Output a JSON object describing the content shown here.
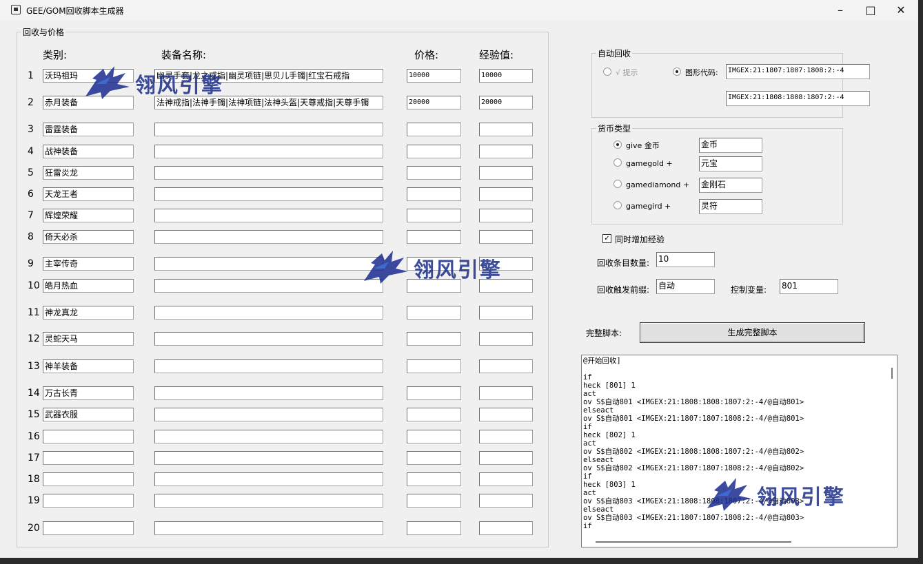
{
  "window": {
    "title": "GEE/GOM回收脚本生成器"
  },
  "recycle": {
    "legend": "回收与价格",
    "headers": {
      "category": "类别:",
      "names": "装备名称:",
      "price": "价格:",
      "exp": "经验值:"
    },
    "rows": [
      {
        "n": "1",
        "category": "沃玛祖玛",
        "names": "幽灵手套|龙之戒指|幽灵项链|思贝儿手镯|红宝石戒指",
        "price": "10000",
        "exp": "10000"
      },
      {
        "n": "2",
        "category": "赤月装备",
        "names": "法神戒指|法神手镯|法神项链|法神头盔|天尊戒指|天尊手镯",
        "price": "20000",
        "exp": "20000"
      },
      {
        "n": "3",
        "category": "雷霆装备",
        "names": "",
        "price": "",
        "exp": ""
      },
      {
        "n": "4",
        "category": "战神装备",
        "names": "",
        "price": "",
        "exp": ""
      },
      {
        "n": "5",
        "category": "狂雷炎龙",
        "names": "",
        "price": "",
        "exp": ""
      },
      {
        "n": "6",
        "category": "天龙王者",
        "names": "",
        "price": "",
        "exp": ""
      },
      {
        "n": "7",
        "category": "辉煌荣耀",
        "names": "",
        "price": "",
        "exp": ""
      },
      {
        "n": "8",
        "category": "倚天必杀",
        "names": "",
        "price": "",
        "exp": ""
      },
      {
        "n": "9",
        "category": "主宰传奇",
        "names": "",
        "price": "",
        "exp": ""
      },
      {
        "n": "10",
        "category": "皓月热血",
        "names": "",
        "price": "",
        "exp": ""
      },
      {
        "n": "11",
        "category": "神龙真龙",
        "names": "",
        "price": "",
        "exp": ""
      },
      {
        "n": "12",
        "category": "灵蛇天马",
        "names": "",
        "price": "",
        "exp": ""
      },
      {
        "n": "13",
        "category": "神羊装备",
        "names": "",
        "price": "",
        "exp": ""
      },
      {
        "n": "14",
        "category": "万古长青",
        "names": "",
        "price": "",
        "exp": ""
      },
      {
        "n": "15",
        "category": "武器衣服",
        "names": "",
        "price": "",
        "exp": ""
      },
      {
        "n": "16",
        "category": "",
        "names": "",
        "price": "",
        "exp": ""
      },
      {
        "n": "17",
        "category": "",
        "names": "",
        "price": "",
        "exp": ""
      },
      {
        "n": "18",
        "category": "",
        "names": "",
        "price": "",
        "exp": ""
      },
      {
        "n": "19",
        "category": "",
        "names": "",
        "price": "",
        "exp": ""
      },
      {
        "n": "20",
        "category": "",
        "names": "",
        "price": "",
        "exp": ""
      }
    ]
  },
  "auto": {
    "legend": "自动回收",
    "hint_label": "√ 提示",
    "graphic_label": "图形代码:",
    "code1": "IMGEX:21:1807:1807:1808:2:-4",
    "code2": "IMGEX:21:1808:1808:1807:2:-4"
  },
  "currency": {
    "legend": "货币类型",
    "options": [
      {
        "label": "give 金币",
        "value": "金币",
        "selected": true
      },
      {
        "label": "gamegold +",
        "value": "元宝",
        "selected": false
      },
      {
        "label": "gamediamond +",
        "value": "金刚石",
        "selected": false
      },
      {
        "label": "gamegird +",
        "value": "灵符",
        "selected": false
      }
    ]
  },
  "settings": {
    "add_exp_label": "同时增加经验",
    "add_exp_checked": "✓",
    "count_label": "回收条目数量:",
    "count_value": "10",
    "prefix_label": "回收触发前缀:",
    "prefix_value": "自动",
    "var_label": "控制变量:",
    "var_value": "801"
  },
  "script": {
    "label": "完整脚本:",
    "generate_button": "生成完整脚本",
    "content": "@开始回收]\n\nif\nheck [801] 1\nact\nov S$自动801 <IMGEX:21:1808:1808:1807:2:-4/@自动801>\nelseact\nov S$自动801 <IMGEX:21:1807:1807:1808:2:-4/@自动801>\nif\nheck [802] 1\nact\nov S$自动802 <IMGEX:21:1808:1808:1807:2:-4/@自动802>\nelseact\nov S$自动802 <IMGEX:21:1807:1807:1808:2:-4/@自动802>\nif\nheck [803] 1\nact\nov S$自动803 <IMGEX:21:1808:1808:1807:2:-4/@自动803>\nelseact\nov S$自动803 <IMGEX:21:1807:1807:1808:2:-4/@自动803>\nif"
  },
  "watermark": {
    "text": "翎风引擎"
  }
}
